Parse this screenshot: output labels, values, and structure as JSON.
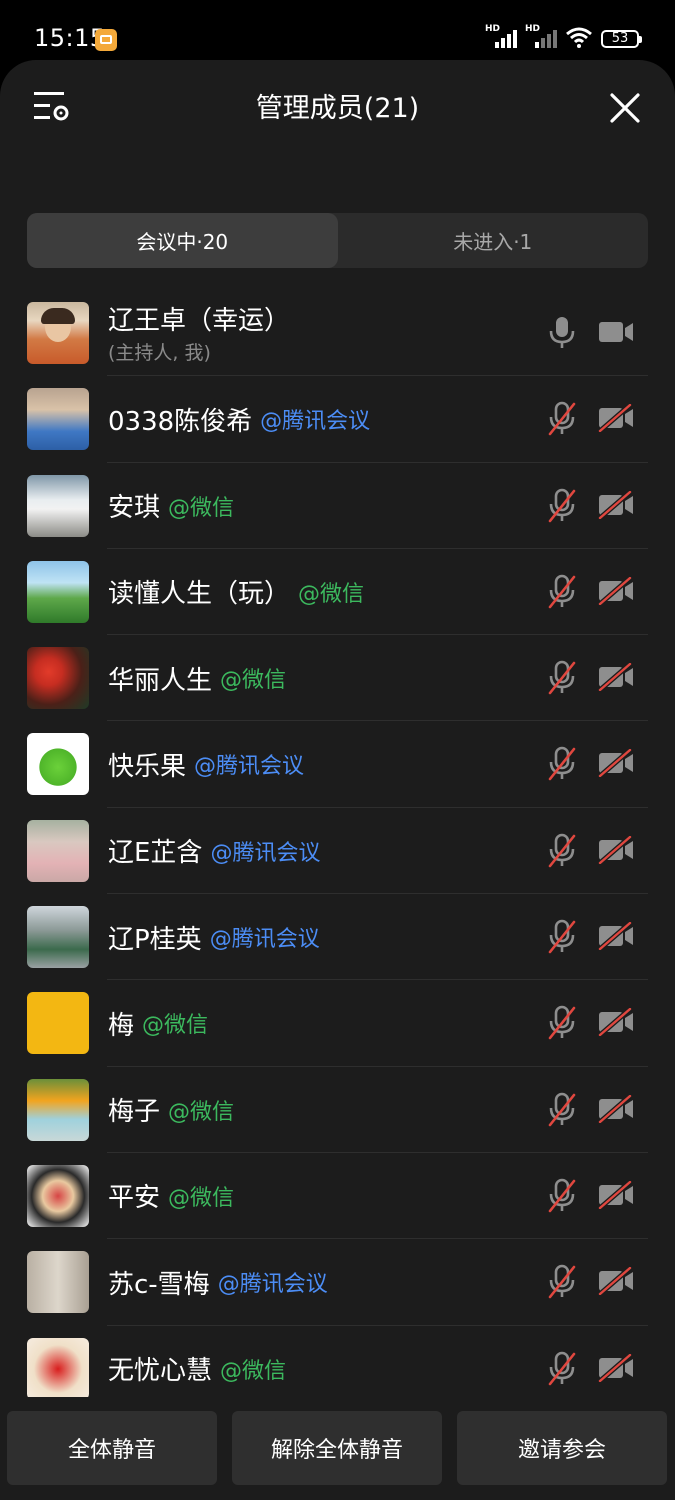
{
  "status_bar": {
    "time": "15:15",
    "network_label": "HD",
    "battery": "53"
  },
  "header": {
    "title": "管理成员(21)"
  },
  "tabs": [
    {
      "label": "会议中·20",
      "active": true
    },
    {
      "label": "未进入·1",
      "active": false
    }
  ],
  "host": {
    "name": "辽王卓（幸运）",
    "subtitle": "(主持人, 我)",
    "mic": "on",
    "camera": "off"
  },
  "members": [
    {
      "name": "0338陈俊希",
      "source": "@腾讯会议",
      "source_type": "tencent",
      "mic": "muted",
      "camera": "off"
    },
    {
      "name": "安琪",
      "source": "@微信",
      "source_type": "wechat",
      "mic": "muted",
      "camera": "off"
    },
    {
      "name": "读懂人生（玩）",
      "source": "@微信",
      "source_type": "wechat",
      "mic": "muted",
      "camera": "off"
    },
    {
      "name": "华丽人生",
      "source": "@微信",
      "source_type": "wechat",
      "mic": "muted",
      "camera": "off"
    },
    {
      "name": "快乐果",
      "source": "@腾讯会议",
      "source_type": "tencent",
      "mic": "muted",
      "camera": "off"
    },
    {
      "name": "辽E芷含",
      "source": "@腾讯会议",
      "source_type": "tencent",
      "mic": "muted",
      "camera": "off"
    },
    {
      "name": "辽P桂英",
      "source": "@腾讯会议",
      "source_type": "tencent",
      "mic": "muted",
      "camera": "off"
    },
    {
      "name": "梅",
      "source": "@微信",
      "source_type": "wechat",
      "mic": "muted",
      "camera": "off"
    },
    {
      "name": "梅子",
      "source": "@微信",
      "source_type": "wechat",
      "mic": "muted",
      "camera": "off"
    },
    {
      "name": "平安",
      "source": "@微信",
      "source_type": "wechat",
      "mic": "muted",
      "camera": "off"
    },
    {
      "name": "苏c-雪梅",
      "source": "@腾讯会议",
      "source_type": "tencent",
      "mic": "muted",
      "camera": "off"
    },
    {
      "name": "无忧心慧",
      "source": "@微信",
      "source_type": "wechat",
      "mic": "muted",
      "camera": "off"
    }
  ],
  "footer": {
    "mute_all": "全体静音",
    "unmute_all": "解除全体静音",
    "invite": "邀请参会"
  },
  "colors": {
    "tencent_tag": "#4c8df5",
    "wechat_tag": "#3cb95e",
    "muted_slash": "#e0473f"
  }
}
